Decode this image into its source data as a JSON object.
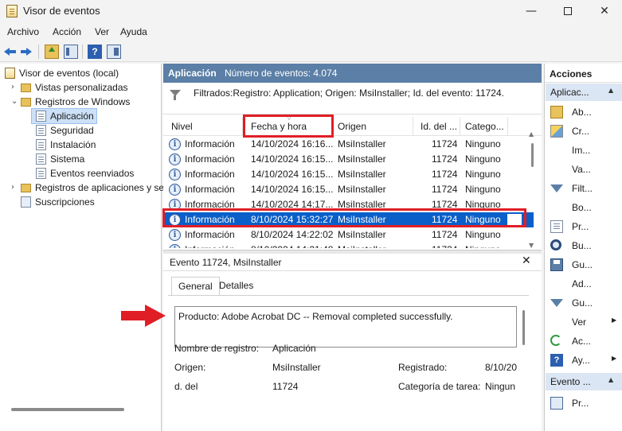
{
  "window": {
    "title": "Visor de eventos",
    "controls": {
      "minimize": "—",
      "maximize": "",
      "close": "✕"
    }
  },
  "menu": [
    "Archivo",
    "Acción",
    "Ver",
    "Ayuda"
  ],
  "toolbar": {
    "help_glyph": "?"
  },
  "tree": {
    "root": "Visor de eventos (local)",
    "custom_views": "Vistas personalizadas",
    "windows_logs": "Registros de Windows",
    "logs": [
      "Aplicación",
      "Seguridad",
      "Instalación",
      "Sistema",
      "Eventos reenviados"
    ],
    "apps_services": "Registros de aplicaciones y se",
    "subscriptions": "Suscripciones",
    "selected": "Aplicación"
  },
  "main": {
    "title": "Aplicación",
    "event_count": "Número de eventos: 4.074",
    "filter_text": "Filtrados:Registro: Application; Origen: MsiInstaller; Id. del evento: 11724.",
    "columns": [
      "Nivel",
      "Fecha y hora",
      "Origen",
      "Id. del ...",
      "Catego..."
    ],
    "rows": [
      {
        "level": "Información",
        "date": "14/10/2024 16:16...",
        "source": "MsiInstaller",
        "id": "11724",
        "category": "Ninguno"
      },
      {
        "level": "Información",
        "date": "14/10/2024 16:15...",
        "source": "MsiInstaller",
        "id": "11724",
        "category": "Ninguno"
      },
      {
        "level": "Información",
        "date": "14/10/2024 16:15...",
        "source": "MsiInstaller",
        "id": "11724",
        "category": "Ninguno"
      },
      {
        "level": "Información",
        "date": "14/10/2024 16:15...",
        "source": "MsiInstaller",
        "id": "11724",
        "category": "Ninguno"
      },
      {
        "level": "Información",
        "date": "14/10/2024 14:17...",
        "source": "MsiInstaller",
        "id": "11724",
        "category": "Ninguno"
      },
      {
        "level": "Información",
        "date": "8/10/2024 15:32:27",
        "source": "MsiInstaller",
        "id": "11724",
        "category": "Ninguno"
      },
      {
        "level": "Información",
        "date": "8/10/2024 14:22:02",
        "source": "MsiInstaller",
        "id": "11724",
        "category": "Ninguno"
      },
      {
        "level": "Información",
        "date": "8/10/2024 14:21:48",
        "source": "MsiInstaller",
        "id": "11724",
        "category": "Ninguno"
      }
    ],
    "selected_row_index": 5
  },
  "detail": {
    "title": "Evento 11724, MsiInstaller",
    "tabs": [
      "General",
      "Detalles"
    ],
    "description": "Producto: Adobe Acrobat DC -- Removal completed successfully.",
    "fields": {
      "log_name_label": "Nombre de registro:",
      "log_name_value": "Aplicación",
      "source_label": "Origen:",
      "source_value": "MsiInstaller",
      "logged_label": "Registrado:",
      "logged_value": "8/10/20",
      "event_id_label": "d. del",
      "event_id_value": "11724",
      "task_category_label": "Categoría de tarea:",
      "task_category_value": "Ningun"
    }
  },
  "actions": {
    "title": "Acciones",
    "section1": "Aplicac...",
    "items": [
      {
        "label": "Ab...",
        "icon": "open-folder-icon"
      },
      {
        "label": "Cr...",
        "icon": "create-view-icon"
      },
      {
        "label": "Im...",
        "icon": ""
      },
      {
        "label": "Va...",
        "icon": ""
      },
      {
        "label": "Filt...",
        "icon": "filter-icon"
      },
      {
        "label": "Bo...",
        "icon": ""
      },
      {
        "label": "Pr...",
        "icon": "properties-icon"
      },
      {
        "label": "Bu...",
        "icon": "find-icon"
      },
      {
        "label": "Gu...",
        "icon": "save-icon"
      },
      {
        "label": "Ad...",
        "icon": ""
      },
      {
        "label": "Gu...",
        "icon": "filter-save-icon"
      },
      {
        "label": "Ver",
        "icon": ""
      },
      {
        "label": "Ac...",
        "icon": "refresh-icon"
      },
      {
        "label": "Ay...",
        "icon": "help-icon"
      }
    ],
    "section2": "Evento ...",
    "section2_items": [
      {
        "label": "Pr...",
        "icon": "event-properties-icon"
      }
    ]
  },
  "colors": {
    "header_blue": "#5b7fa6",
    "selection_blue": "#0a5fc9",
    "highlight_red": "#e01e25"
  }
}
